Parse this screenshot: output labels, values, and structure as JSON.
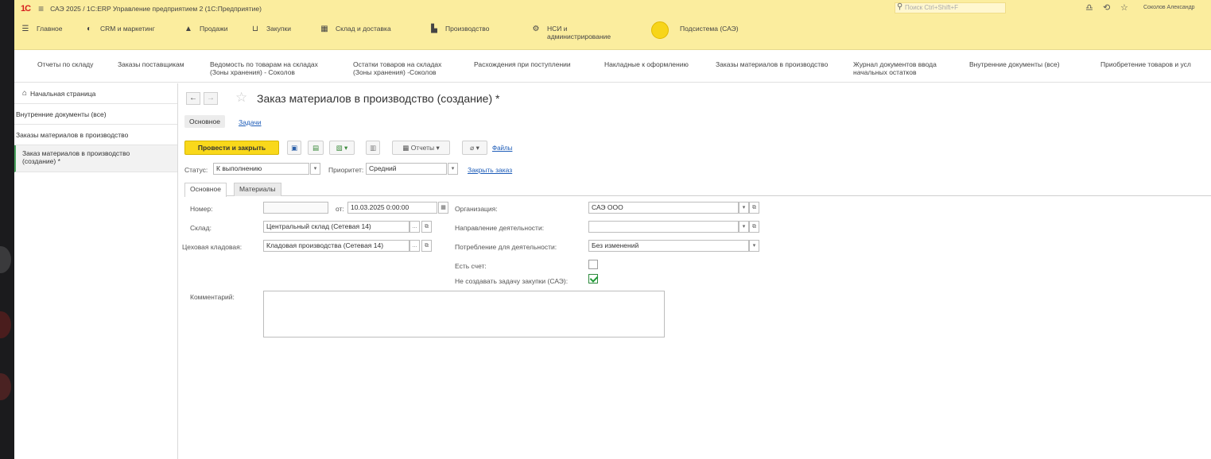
{
  "titlebar": {
    "logo": "1С",
    "title": "САЭ 2025 / 1С:ERP Управление предприятием 2  (1С:Предприятие)",
    "search_placeholder": "Поиск Ctrl+Shift+F",
    "user": "Соколов Александр"
  },
  "sections": [
    {
      "label_line1": "Главное",
      "label_line2": "",
      "icon": "hamburger-icon"
    },
    {
      "label_line1": "CRM и маркетинг",
      "label_line2": "",
      "icon": "crm-icon"
    },
    {
      "label_line1": "Продажи",
      "label_line2": "",
      "icon": "sales-icon"
    },
    {
      "label_line1": "Закупки",
      "label_line2": "",
      "icon": "cart-icon"
    },
    {
      "label_line1": "Склад и доставка",
      "label_line2": "",
      "icon": "warehouse-icon"
    },
    {
      "label_line1": "Производство",
      "label_line2": "",
      "icon": "factory-icon"
    },
    {
      "label_line1": "НСИ и",
      "label_line2": "администрирование",
      "icon": "gear-icon"
    },
    {
      "label_line1": "Подсистема (САЭ)",
      "label_line2": "",
      "icon": "circle-icon"
    }
  ],
  "functions": [
    {
      "l1": "Отчеты по складу",
      "l2": ""
    },
    {
      "l1": "Заказы поставщикам",
      "l2": ""
    },
    {
      "l1": "Ведомость по товарам на складах",
      "l2": "(Зоны хранения) - Соколов"
    },
    {
      "l1": "Остатки товаров на складах",
      "l2": "(Зоны хранения) -Соколов"
    },
    {
      "l1": "Расхождения при поступлении",
      "l2": ""
    },
    {
      "l1": "Накладные к оформлению",
      "l2": ""
    },
    {
      "l1": "Заказы материалов в производство",
      "l2": ""
    },
    {
      "l1": "Журнал документов ввода",
      "l2": "начальных остатков"
    },
    {
      "l1": "Внутренние документы (все)",
      "l2": ""
    },
    {
      "l1": "Приобретение товаров и усл",
      "l2": ""
    }
  ],
  "nav": {
    "home": "Начальная страница",
    "items": [
      "Внутренние документы (все)",
      "Заказы материалов в производство"
    ],
    "active_l1": "Заказ материалов в производство",
    "active_l2": "(создание) *"
  },
  "form": {
    "title": "Заказ материалов в производство (создание) *",
    "tab_main": "Основное",
    "tab_tasks": "Задачи",
    "post_close": "Провести и закрыть",
    "reports": "Отчеты",
    "files": "Файлы",
    "status_label": "Статус:",
    "status_value": "К выполнению",
    "priority_label": "Приоритет:",
    "priority_value": "Средний",
    "close_order": "Закрыть заказ",
    "inner_tab_main": "Основное",
    "inner_tab_materials": "Материалы",
    "number_label": "Номер:",
    "number_value": "",
    "date_label": "от:",
    "date_value": "10.03.2025  0:00:00",
    "org_label": "Организация:",
    "org_value": "САЭ ООО",
    "warehouse_label": "Склад:",
    "warehouse_value": "Центральный склад (Сетевая 14)",
    "direction_label": "Направление деятельности:",
    "direction_value": "",
    "shop_label": "Цеховая кладовая:",
    "shop_value": "Кладовая производства (Сетевая 14)",
    "consumption_label": "Потребление для деятельности:",
    "consumption_value": "Без изменений",
    "invoice_label": "Есть счет:",
    "no_task_label": "Не создавать задачу закупки (САЭ):",
    "comment_label": "Комментарий:"
  },
  "colors": {
    "sections_bg": "#fbed9e",
    "primary_button": "#f9d81b",
    "link": "#1d5cb8",
    "active_marker": "#4aa35e"
  }
}
